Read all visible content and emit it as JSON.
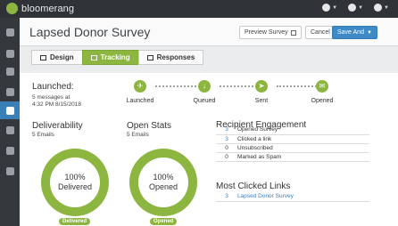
{
  "brand": {
    "name": "bloomerang",
    "color": "#8cb640"
  },
  "top_icons": [
    {
      "name": "help-icon"
    },
    {
      "name": "bell-icon"
    },
    {
      "name": "user-icon"
    }
  ],
  "sidebar": {
    "items": [
      {
        "name": "home-icon"
      },
      {
        "name": "people-icon"
      },
      {
        "name": "chart-icon"
      },
      {
        "name": "documents-icon"
      },
      {
        "name": "email-icon",
        "active": true
      },
      {
        "name": "share-icon"
      },
      {
        "name": "reports-icon"
      },
      {
        "name": "settings-icon"
      }
    ]
  },
  "header": {
    "title": "Lapsed Donor Survey",
    "preview_label": "Preview Survey",
    "cancel_label": "Cancel",
    "save_label": "Save And"
  },
  "tabs": [
    {
      "label": "Design",
      "active": false
    },
    {
      "label": "Tracking",
      "active": true
    },
    {
      "label": "Responses",
      "active": false
    }
  ],
  "launch": {
    "label": "Launched:",
    "sub_line1": "5 messages at",
    "sub_line2": "4:32 PM 8/15/2018"
  },
  "steps": [
    "Launched",
    "Queued",
    "Sent",
    "Opened"
  ],
  "deliverability": {
    "title": "Deliverability",
    "sub": "5 Emails",
    "value": "100%",
    "word": "Delivered",
    "pill": "Delivered",
    "fraction": 1.0
  },
  "open_stats": {
    "title": "Open Stats",
    "sub": "5 Emails",
    "value": "100%",
    "word": "Opened",
    "pill": "Opened",
    "fraction": 1.0
  },
  "engagement": {
    "title": "Recipient Engagement",
    "rows": [
      {
        "count": "3",
        "label": "Opened Survey"
      },
      {
        "count": "3",
        "label": "Clicked a link"
      },
      {
        "count": "0",
        "label": "Unsubscribed"
      },
      {
        "count": "0",
        "label": "Marked as Spam"
      }
    ]
  },
  "most_clicked": {
    "title": "Most Clicked Links",
    "rows": [
      {
        "count": "3",
        "label": "Lapsed Donor Survey"
      }
    ]
  }
}
